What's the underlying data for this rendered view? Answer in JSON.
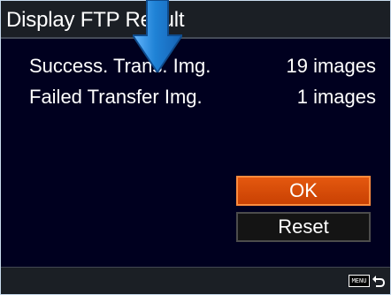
{
  "screen": {
    "title": "Display FTP Result",
    "rows": [
      {
        "label": "Success. Trans. Img.",
        "value": "19 images"
      },
      {
        "label": "Failed Transfer Img.",
        "value": "1 images"
      }
    ]
  },
  "actions": {
    "ok_label": "OK",
    "reset_label": "Reset"
  },
  "footer": {
    "menu_label": "MENU"
  },
  "icons": {
    "menu": "menu-icon",
    "back": "back-icon",
    "overlay_arrow": "down-arrow-icon"
  },
  "colors": {
    "accent": "#d14b07",
    "background": "#00001f",
    "titlebar": "#1b1f25",
    "overlay_arrow": "#1f82d6"
  }
}
